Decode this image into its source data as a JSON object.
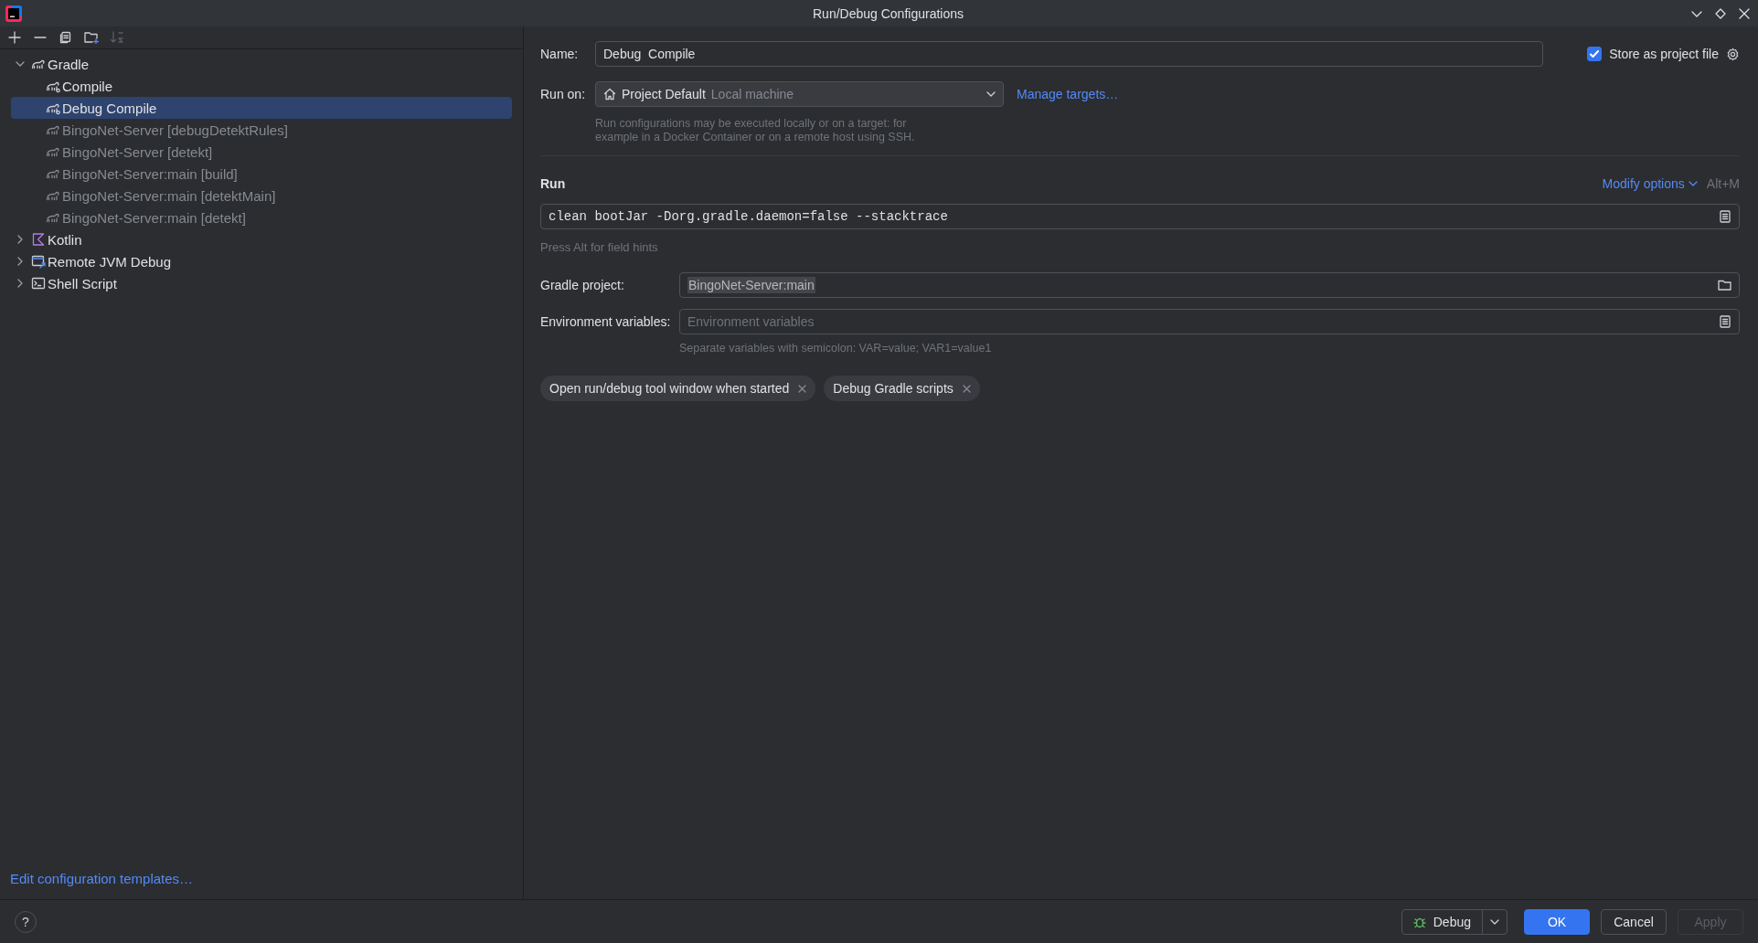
{
  "window": {
    "title": "Run/Debug Configurations"
  },
  "toolbar": [
    {
      "kind": "add",
      "disabled": false
    },
    {
      "kind": "remove",
      "disabled": false
    },
    {
      "kind": "copy",
      "disabled": false
    },
    {
      "kind": "folder",
      "disabled": false
    },
    {
      "kind": "sort",
      "disabled": true
    }
  ],
  "tree": [
    {
      "label": "Gradle",
      "kind": "gradle",
      "expanded": true,
      "selected": false,
      "children": [
        {
          "label": "Compile",
          "kind": "gradle",
          "temporary": false,
          "selected": false
        },
        {
          "label": "Debug  Compile",
          "kind": "gradle",
          "temporary": false,
          "selected": true
        },
        {
          "label": "BingoNet-Server [debugDetektRules]",
          "kind": "gradle",
          "temporary": true,
          "selected": false
        },
        {
          "label": "BingoNet-Server [detekt]",
          "kind": "gradle",
          "temporary": true,
          "selected": false
        },
        {
          "label": "BingoNet-Server:main [build]",
          "kind": "gradle",
          "temporary": true,
          "selected": false
        },
        {
          "label": "BingoNet-Server:main [detektMain]",
          "kind": "gradle",
          "temporary": true,
          "selected": false
        },
        {
          "label": "BingoNet-Server:main [detekt]",
          "kind": "gradle",
          "temporary": true,
          "selected": false
        }
      ]
    },
    {
      "label": "Kotlin",
      "kind": "kotlin",
      "expanded": false,
      "selected": false
    },
    {
      "label": "Remote JVM Debug",
      "kind": "remote",
      "expanded": false,
      "selected": false
    },
    {
      "label": "Shell Script",
      "kind": "shell",
      "expanded": false,
      "selected": false
    }
  ],
  "templates_link": "Edit configuration templates…",
  "form": {
    "name": {
      "label": "Name:",
      "value": "Debug  Compile"
    },
    "store": {
      "label": "Store as project file",
      "checked": true
    },
    "run_on": {
      "label": "Run on:",
      "value": "Project Default",
      "detail": "Local machine",
      "link": "Manage targets…",
      "hint_lines": [
        "Run configurations may be executed locally or on a target: for",
        "example in a Docker Container or on a remote host using SSH."
      ]
    },
    "run": {
      "title": "Run",
      "modify": "Modify options",
      "shortcut": "Alt+M",
      "command": "clean bootJar -Dorg.gradle.daemon=false --stacktrace",
      "hint": "Press Alt for field hints"
    },
    "fields": [
      {
        "label": "Gradle project:",
        "value": "BingoNet-Server:main",
        "kind": "path"
      },
      {
        "label": "Environment variables:",
        "placeholder": "Environment variables",
        "kind": "env",
        "note": "Separate variables with semicolon: VAR=value; VAR1=value1"
      }
    ],
    "tags": [
      "Open run/debug tool window when started",
      "Debug Gradle scripts"
    ]
  },
  "footer": {
    "help": "?",
    "run_button": "Debug",
    "buttons": [
      {
        "label": "OK",
        "kind": "primary",
        "disabled": false
      },
      {
        "label": "Cancel",
        "kind": "normal",
        "disabled": false
      },
      {
        "label": "Apply",
        "kind": "normal",
        "disabled": true
      }
    ]
  }
}
